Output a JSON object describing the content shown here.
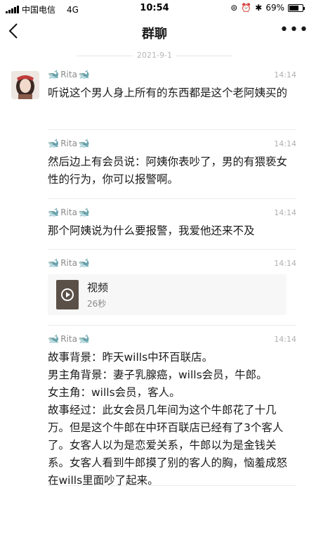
{
  "status_bar": {
    "carrier": "中国电信",
    "network": "4G",
    "time": "10:54",
    "battery": "69%"
  },
  "nav": {
    "back_icon": "chevron-left-icon",
    "title": "群聊",
    "more_icon": "more-dots-icon"
  },
  "date_separator": "2021-9-1",
  "messages": [
    {
      "sender": "Rita",
      "time": "14:14",
      "text": "听说这个男人身上所有的东西都是这个老阿姨买的"
    },
    {
      "sender": "Rita",
      "time": "14:14",
      "text": "然后边上有会员说：阿姨你表吵了，男的有猥亵女性的行为，你可以报警啊。"
    },
    {
      "sender": "Rita",
      "time": "14:14",
      "text": "那个阿姨说为什么要报警，我爱他还来不及"
    },
    {
      "sender": "Rita",
      "time": "14:14",
      "video_title": "视频",
      "video_duration": "26秒"
    },
    {
      "sender": "Rita",
      "time": "14:14",
      "text": "故事背景：昨天wills中环百联店。\n男主角背景：妻子乳腺癌，wills会员，牛郎。\n女主角：wills会员，客人。\n故事经过：此女会员几年间为这个牛郎花了十几万。但是这个牛郎在中环百联店已经有了3个客人了。女客人以为是恋爱关系，牛郎以为是金钱关系。女客人看到牛郎摸了别的客人的胸，恼羞成怒在wills里面吵了起来。"
    }
  ],
  "colors": {
    "whale": "#3b7fd6",
    "meta": "#8a8a8a"
  }
}
